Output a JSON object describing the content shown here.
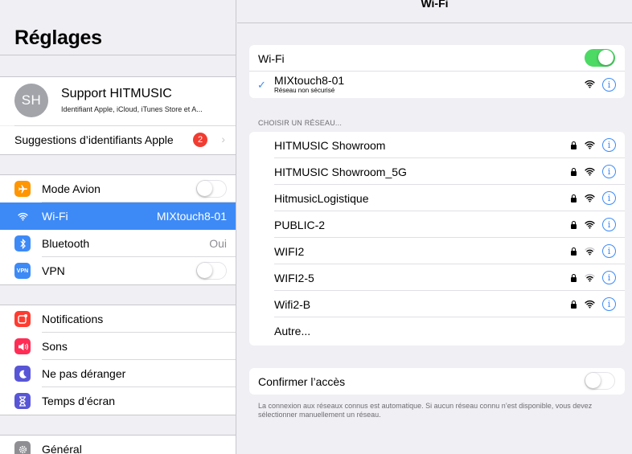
{
  "sidebar": {
    "title": "Réglages",
    "profile": {
      "initials": "SH",
      "name": "Support HITMUSIC",
      "subtitle": "Identifiant Apple, iCloud, iTunes Store et A..."
    },
    "suggestions": {
      "label": "Suggestions d’identifiants Apple",
      "badge": "2"
    },
    "connectivity": [
      {
        "label": "Mode Avion",
        "icon": "airplane-icon",
        "color": "#ff9500",
        "value": "",
        "toggle": "off"
      },
      {
        "label": "Wi-Fi",
        "icon": "wifi-icon",
        "color": "#3d8af7",
        "value": "MIXtouch8-01",
        "selected": true
      },
      {
        "label": "Bluetooth",
        "icon": "bluetooth-icon",
        "color": "#3d8af7",
        "value": "Oui"
      },
      {
        "label": "VPN",
        "icon": "vpn-icon",
        "color": "#3d8af7",
        "icon_text": "VPN",
        "value": "",
        "toggle": "off"
      }
    ],
    "notifications": [
      {
        "label": "Notifications",
        "icon": "notifications-icon",
        "color": "#ff3b30"
      },
      {
        "label": "Sons",
        "icon": "sound-icon",
        "color": "#ff2d55"
      },
      {
        "label": "Ne pas déranger",
        "icon": "moon-icon",
        "color": "#5856d6"
      },
      {
        "label": "Temps d’écran",
        "icon": "hourglass-icon",
        "color": "#5856d6"
      }
    ],
    "general": {
      "label": "Général",
      "icon": "gear-icon",
      "color": "#8e8e93"
    }
  },
  "main": {
    "nav_title": "Wi-Fi",
    "wifi_toggle": {
      "label": "Wi-Fi",
      "state": "on"
    },
    "connected": {
      "name": "MIXtouch8-01",
      "subtitle": "Réseau non sécurisé"
    },
    "section_header": "CHOISIR UN RÉSEAU...",
    "networks": [
      {
        "name": "HITMUSIC Showroom",
        "locked": true,
        "signal": 3
      },
      {
        "name": "HITMUSIC Showroom_5G",
        "locked": true,
        "signal": 3
      },
      {
        "name": "HitmusicLogistique",
        "locked": true,
        "signal": 3
      },
      {
        "name": "PUBLIC-2",
        "locked": true,
        "signal": 3
      },
      {
        "name": "WIFI2",
        "locked": true,
        "signal": 2
      },
      {
        "name": "WIFI2-5",
        "locked": true,
        "signal": 2
      },
      {
        "name": "Wifi2-B",
        "locked": true,
        "signal": 3
      }
    ],
    "other": "Autre...",
    "ask_join": {
      "label": "Confirmer l’accès",
      "state": "off"
    },
    "footer": "La connexion aux réseaux connus est automatique. Si aucun réseau connu n’est disponible, vous devez sélectionner manuellement un réseau."
  }
}
